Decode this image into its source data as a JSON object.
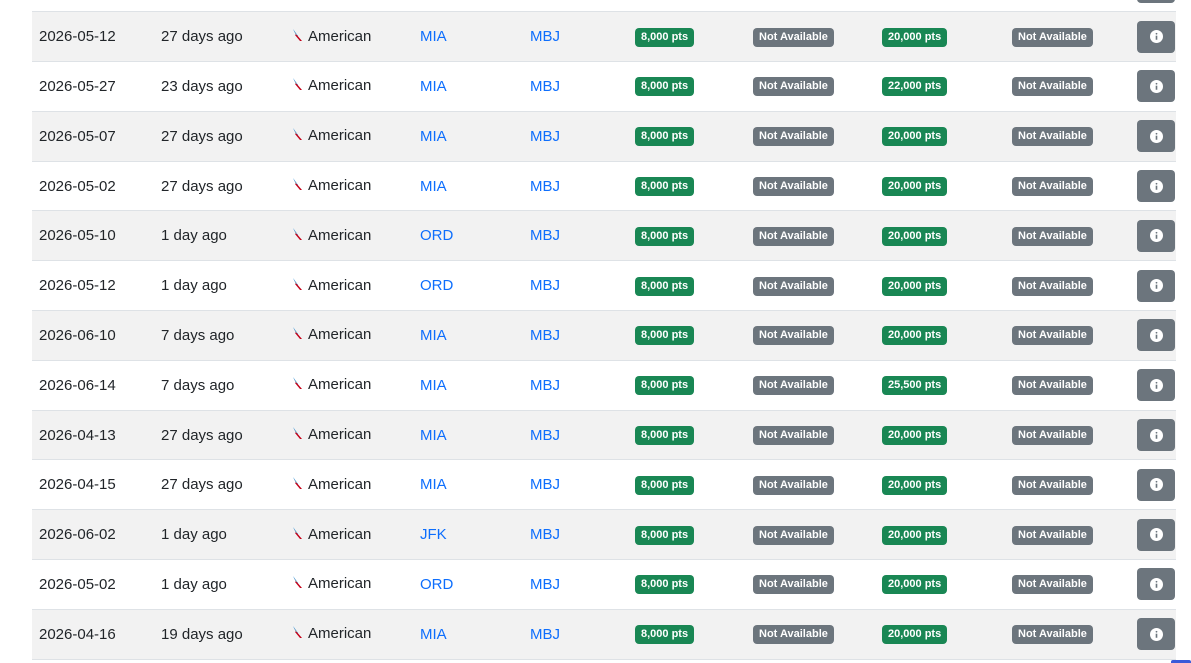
{
  "results_table": {
    "rows": [
      {
        "date": "",
        "seen": "",
        "program": "",
        "origin": "",
        "dest": "",
        "economy": "",
        "premium": "",
        "business": "",
        "first": "",
        "partial": true
      },
      {
        "date": "2026-05-12",
        "seen": "27 days ago",
        "program": "American",
        "origin": "MIA",
        "dest": "MBJ",
        "economy": "8,000 pts",
        "premium": "Not Available",
        "business": "20,000 pts",
        "first": "Not Available"
      },
      {
        "date": "2026-05-27",
        "seen": "23 days ago",
        "program": "American",
        "origin": "MIA",
        "dest": "MBJ",
        "economy": "8,000 pts",
        "premium": "Not Available",
        "business": "22,000 pts",
        "first": "Not Available"
      },
      {
        "date": "2026-05-07",
        "seen": "27 days ago",
        "program": "American",
        "origin": "MIA",
        "dest": "MBJ",
        "economy": "8,000 pts",
        "premium": "Not Available",
        "business": "20,000 pts",
        "first": "Not Available"
      },
      {
        "date": "2026-05-02",
        "seen": "27 days ago",
        "program": "American",
        "origin": "MIA",
        "dest": "MBJ",
        "economy": "8,000 pts",
        "premium": "Not Available",
        "business": "20,000 pts",
        "first": "Not Available"
      },
      {
        "date": "2026-05-10",
        "seen": "1 day ago",
        "program": "American",
        "origin": "ORD",
        "dest": "MBJ",
        "economy": "8,000 pts",
        "premium": "Not Available",
        "business": "20,000 pts",
        "first": "Not Available"
      },
      {
        "date": "2026-05-12",
        "seen": "1 day ago",
        "program": "American",
        "origin": "ORD",
        "dest": "MBJ",
        "economy": "8,000 pts",
        "premium": "Not Available",
        "business": "20,000 pts",
        "first": "Not Available"
      },
      {
        "date": "2026-06-10",
        "seen": "7 days ago",
        "program": "American",
        "origin": "MIA",
        "dest": "MBJ",
        "economy": "8,000 pts",
        "premium": "Not Available",
        "business": "20,000 pts",
        "first": "Not Available"
      },
      {
        "date": "2026-06-14",
        "seen": "7 days ago",
        "program": "American",
        "origin": "MIA",
        "dest": "MBJ",
        "economy": "8,000 pts",
        "premium": "Not Available",
        "business": "25,500 pts",
        "first": "Not Available"
      },
      {
        "date": "2026-04-13",
        "seen": "27 days ago",
        "program": "American",
        "origin": "MIA",
        "dest": "MBJ",
        "economy": "8,000 pts",
        "premium": "Not Available",
        "business": "20,000 pts",
        "first": "Not Available"
      },
      {
        "date": "2026-04-15",
        "seen": "27 days ago",
        "program": "American",
        "origin": "MIA",
        "dest": "MBJ",
        "economy": "8,000 pts",
        "premium": "Not Available",
        "business": "20,000 pts",
        "first": "Not Available"
      },
      {
        "date": "2026-06-02",
        "seen": "1 day ago",
        "program": "American",
        "origin": "JFK",
        "dest": "MBJ",
        "economy": "8,000 pts",
        "premium": "Not Available",
        "business": "20,000 pts",
        "first": "Not Available"
      },
      {
        "date": "2026-05-02",
        "seen": "1 day ago",
        "program": "American",
        "origin": "ORD",
        "dest": "MBJ",
        "economy": "8,000 pts",
        "premium": "Not Available",
        "business": "20,000 pts",
        "first": "Not Available"
      },
      {
        "date": "2026-04-16",
        "seen": "19 days ago",
        "program": "American",
        "origin": "MIA",
        "dest": "MBJ",
        "economy": "8,000 pts",
        "premium": "Not Available",
        "business": "20,000 pts",
        "first": "Not Available"
      }
    ]
  },
  "icons": {
    "airline_logo": "american-airlines-logo-icon",
    "info": "info-circle-icon"
  },
  "colors": {
    "available_badge": "#198754",
    "unavailable_badge": "#6c757d",
    "link": "#0d6efd",
    "info_button": "#6c757d",
    "row_stripe": "#f2f2f2"
  }
}
